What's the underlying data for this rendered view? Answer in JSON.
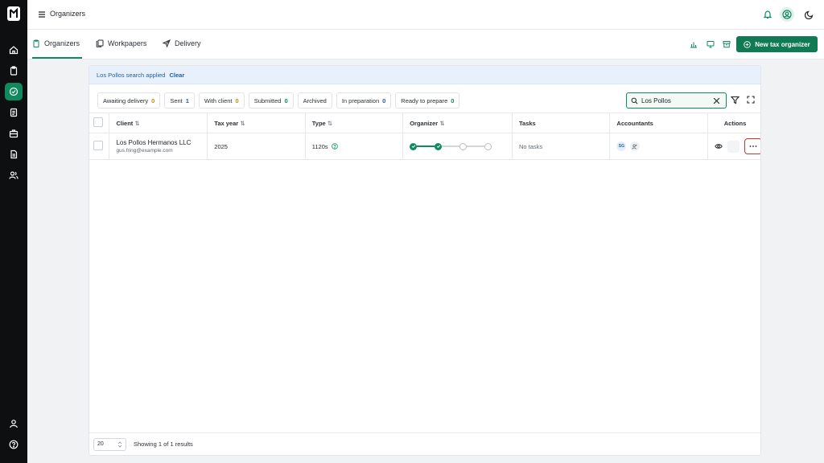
{
  "header": {
    "title": "Organizers"
  },
  "tabs": [
    {
      "label": "Organizers",
      "icon": "clipboard-icon",
      "active": true
    },
    {
      "label": "Workpapers",
      "icon": "copy-icon",
      "active": false
    },
    {
      "label": "Delivery",
      "icon": "send-icon",
      "active": false
    }
  ],
  "toolbar": {
    "new_button_label": "New tax organizer"
  },
  "banner": {
    "text": "Los Pollos search applied",
    "clear_label": "Clear"
  },
  "filters": [
    {
      "label": "Awaiting delivery",
      "count": "0",
      "color": "orange"
    },
    {
      "label": "Sent",
      "count": "1",
      "color": "blue"
    },
    {
      "label": "With client",
      "count": "0",
      "color": "orange"
    },
    {
      "label": "Submitted",
      "count": "0",
      "color": "green"
    },
    {
      "label": "Archived",
      "count": "",
      "color": ""
    },
    {
      "label": "In preparation",
      "count": "0",
      "color": "blue"
    },
    {
      "label": "Ready to prepare",
      "count": "0",
      "color": "green"
    }
  ],
  "search": {
    "value": "Los Pollos"
  },
  "table": {
    "columns": {
      "client": "Client",
      "tax_year": "Tax year",
      "type": "Type",
      "organizer": "Organizer",
      "tasks": "Tasks",
      "accountants": "Accountants",
      "actions": "Actions"
    },
    "rows": [
      {
        "client_name": "Los Pollos Hermanos LLC",
        "client_email": "gus.fring@example.com",
        "tax_year": "2025",
        "type": "1120s",
        "organizer_steps": [
          "done",
          "done",
          "todo",
          "todo"
        ],
        "tasks": "No tasks",
        "accountant_initials": "SG"
      }
    ]
  },
  "footer": {
    "page_size": "20",
    "results_text": "Showing 1 of 1 results"
  },
  "colors": {
    "accent": "#0f8a5f",
    "primary_button": "#0f7a54",
    "sidebar": "#0e0f10",
    "highlight_border": "#d9342b"
  }
}
